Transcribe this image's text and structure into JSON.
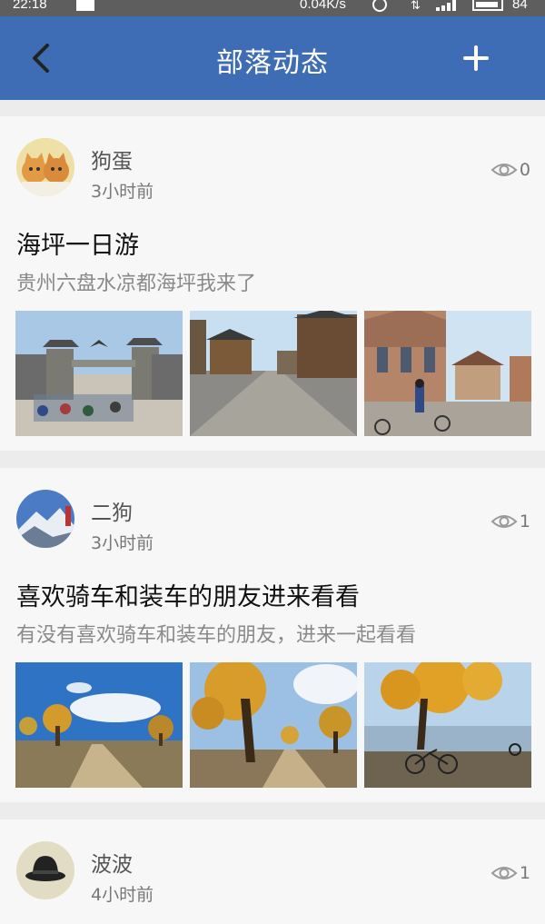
{
  "status_bar": {
    "time": "22:18",
    "network_speed": "0.04K/s",
    "battery_level": "84"
  },
  "header": {
    "title": "部落动态",
    "back_icon": "chevron-left-icon",
    "add_icon": "plus-icon"
  },
  "posts": [
    {
      "username": "狗蛋",
      "time_ago": "3小时前",
      "views": "0",
      "title": "海坪一日游",
      "description": "贵州六盘水凉都海坪我来了",
      "avatar": "cats-avatar",
      "photos": [
        "gate-cyclists-photo",
        "old-street-photo",
        "european-houses-cyclists-photo"
      ]
    },
    {
      "username": "二狗",
      "time_ago": "3小时前",
      "views": "1",
      "title": "喜欢骑车和装车的朋友进来看看",
      "description": "有没有喜欢骑车和装车的朋友，进来一起看看",
      "avatar": "snow-mountain-avatar",
      "photos": [
        "desert-poplar-road-photo",
        "autumn-poplar-photo",
        "lakeside-bike-photo"
      ]
    },
    {
      "username": "波波",
      "time_ago": "4小时前",
      "views": "1",
      "avatar": "bowler-hat-avatar"
    }
  ],
  "colors": {
    "appbar": "#3e6db5",
    "background": "#ececec",
    "card": "#f7f7f7"
  }
}
